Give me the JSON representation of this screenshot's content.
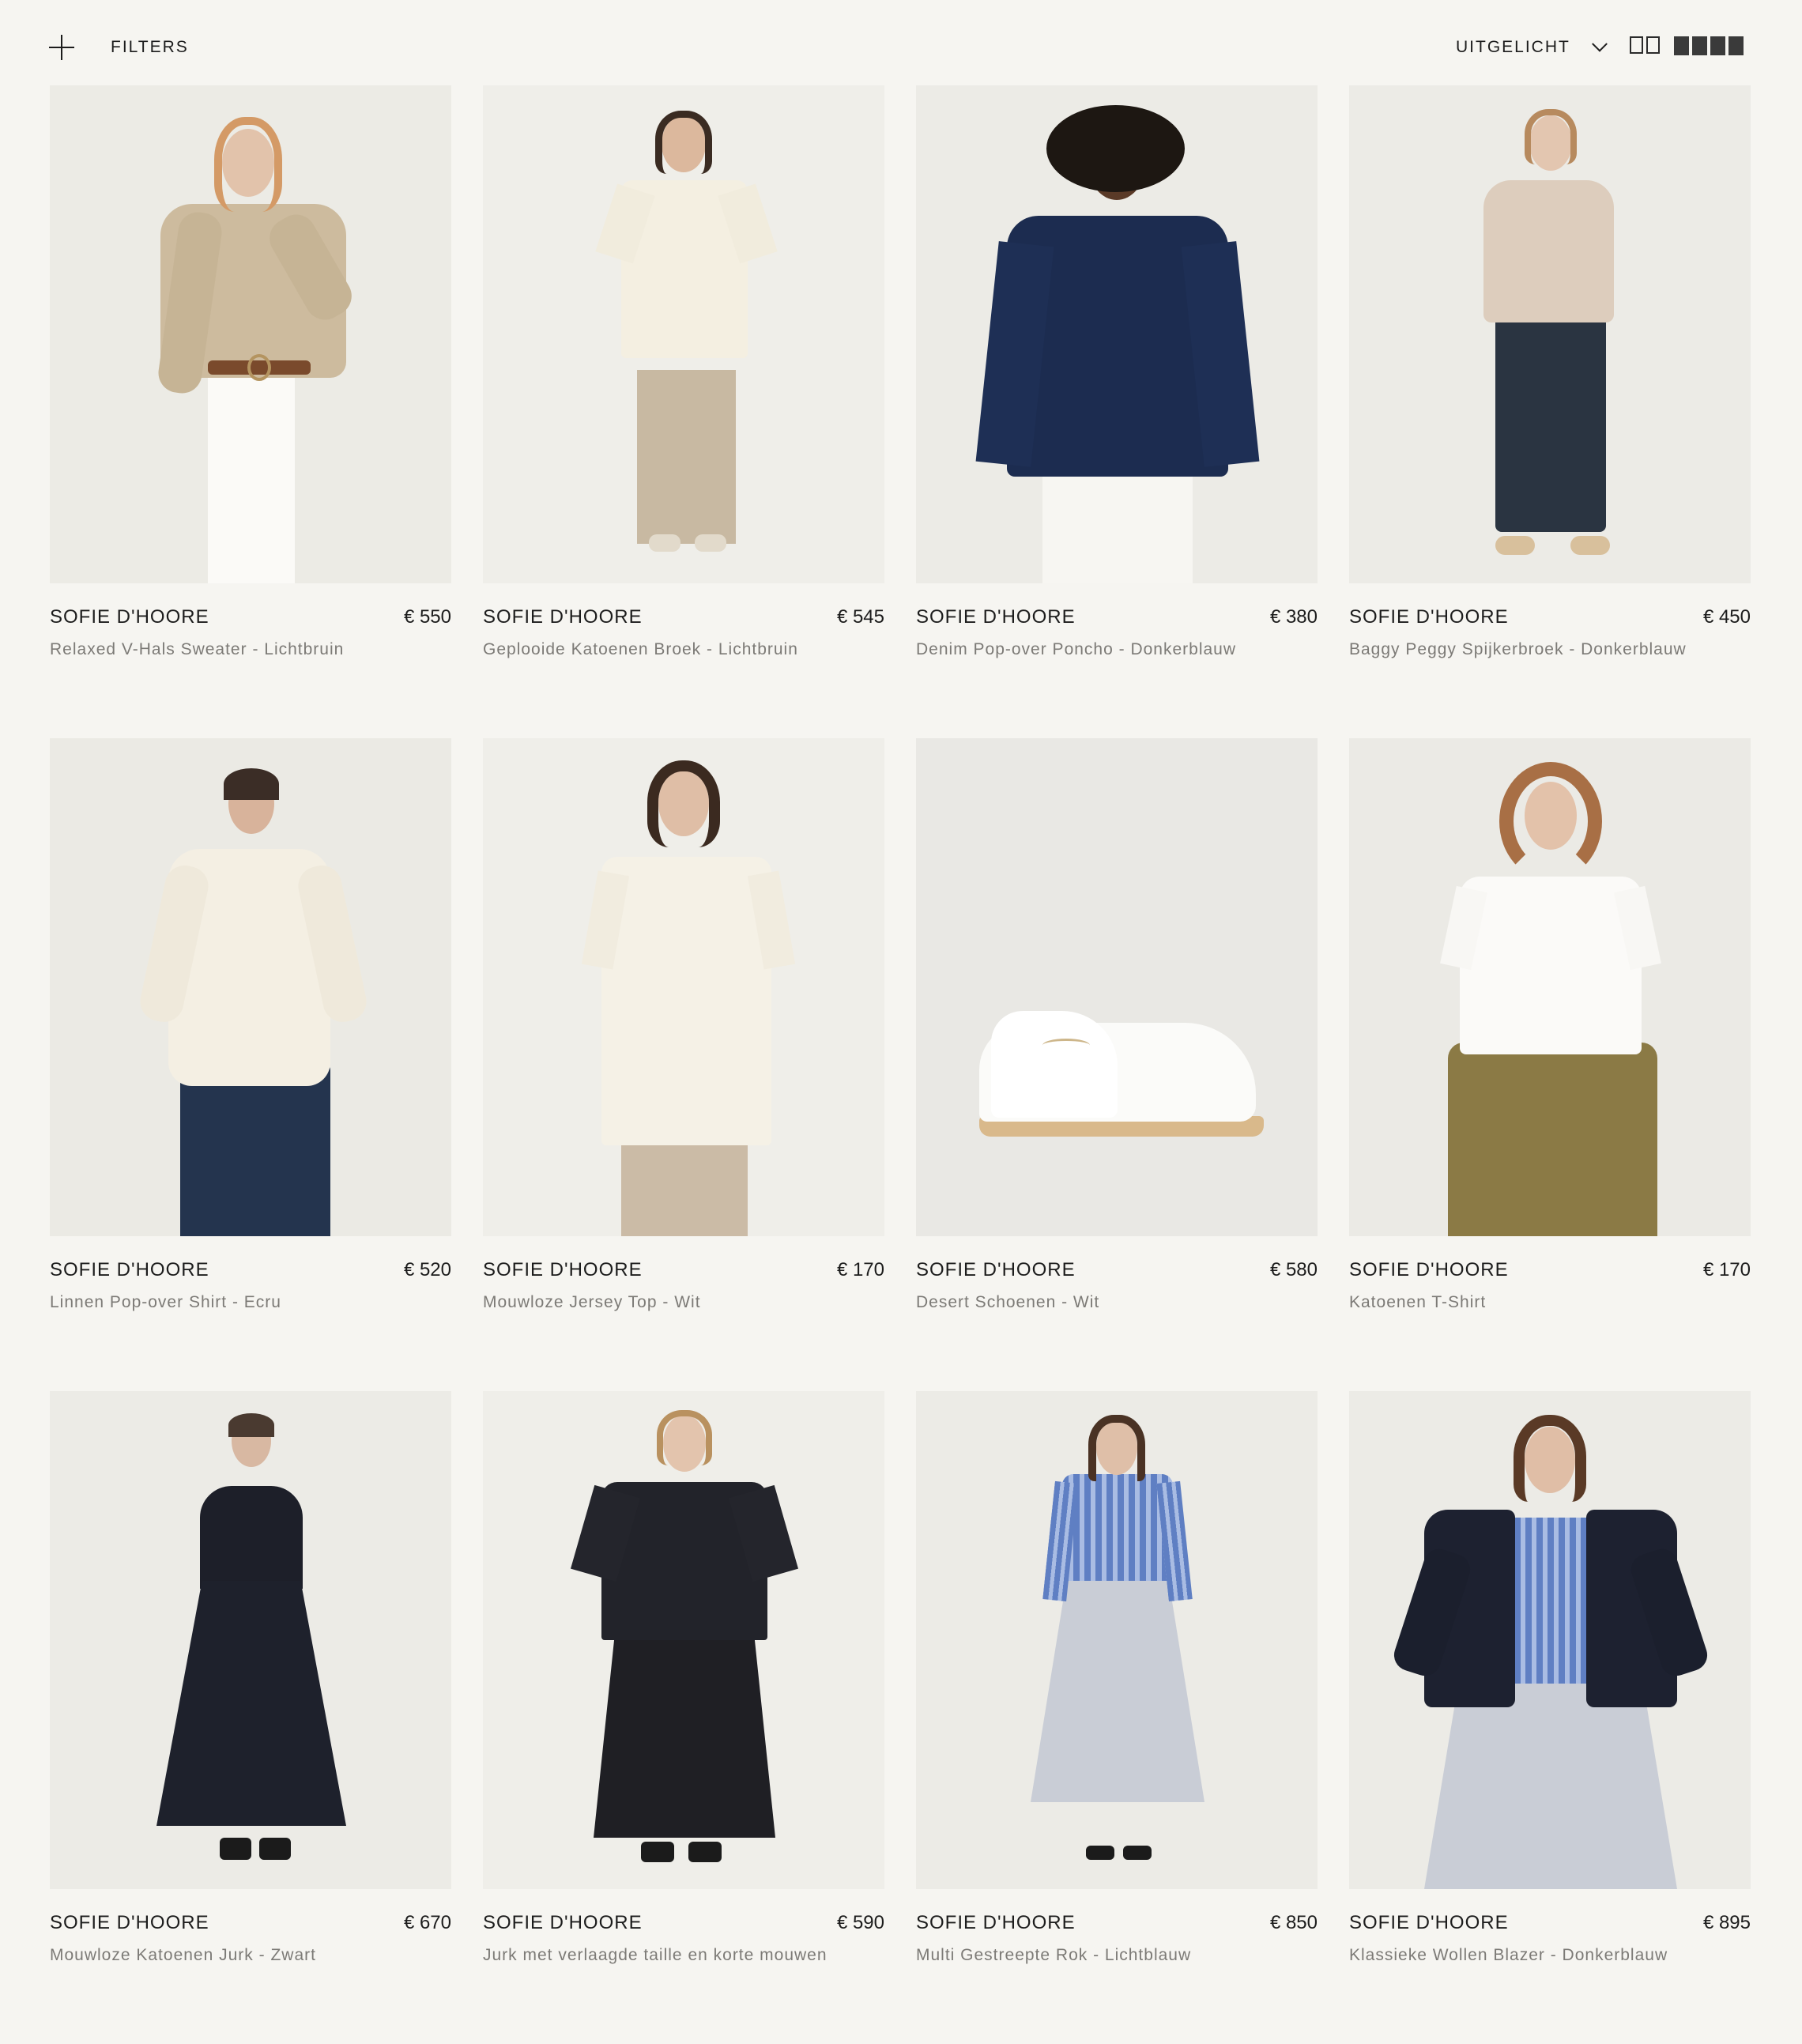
{
  "toolbar": {
    "filters_label": "FILTERS",
    "sort_label": "UITGELICHT"
  },
  "products": [
    {
      "brand": "SOFIE D'HOORE",
      "price": "€ 550",
      "name": "Relaxed V-Hals Sweater - Lichtbruin"
    },
    {
      "brand": "SOFIE D'HOORE",
      "price": "€ 545",
      "name": "Geplooide Katoenen Broek - Lichtbruin"
    },
    {
      "brand": "SOFIE D'HOORE",
      "price": "€ 380",
      "name": "Denim Pop-over Poncho - Donkerblauw"
    },
    {
      "brand": "SOFIE D'HOORE",
      "price": "€ 450",
      "name": "Baggy Peggy Spijkerbroek - Donkerblauw"
    },
    {
      "brand": "SOFIE D'HOORE",
      "price": "€ 520",
      "name": "Linnen Pop-over Shirt - Ecru"
    },
    {
      "brand": "SOFIE D'HOORE",
      "price": "€ 170",
      "name": "Mouwloze Jersey Top - Wit"
    },
    {
      "brand": "SOFIE D'HOORE",
      "price": "€ 580",
      "name": "Desert Schoenen - Wit"
    },
    {
      "brand": "SOFIE D'HOORE",
      "price": "€ 170",
      "name": "Katoenen T-Shirt"
    },
    {
      "brand": "SOFIE D'HOORE",
      "price": "€ 670",
      "name": "Mouwloze Katoenen Jurk - Zwart"
    },
    {
      "brand": "SOFIE D'HOORE",
      "price": "€ 590",
      "name": "Jurk met verlaagde taille en korte mouwen"
    },
    {
      "brand": "SOFIE D'HOORE",
      "price": "€ 850",
      "name": "Multi Gestreepte Rok - Lichtblauw"
    },
    {
      "brand": "SOFIE D'HOORE",
      "price": "€ 895",
      "name": "Klassieke Wollen Blazer - Donkerblauw"
    }
  ],
  "colors": {
    "background": "#f6f5f1",
    "photo_background": "#ecebe6",
    "text": "#1c1c1c",
    "muted_text": "#7c7a76"
  }
}
